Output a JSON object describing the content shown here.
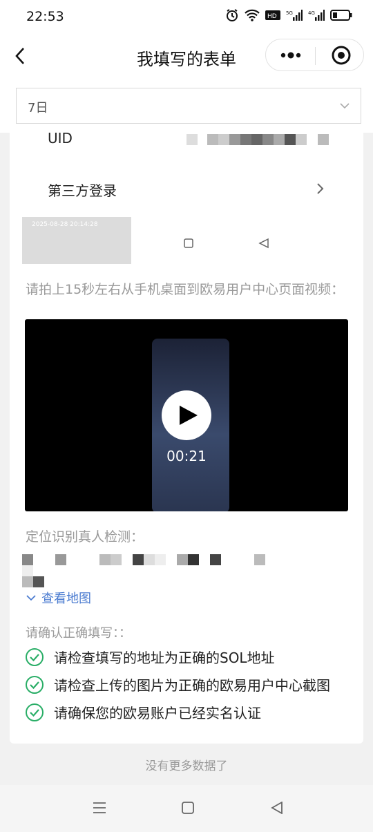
{
  "status": {
    "time": "22:53"
  },
  "nav": {
    "title": "我填写的表单"
  },
  "filter": {
    "selected": "7日"
  },
  "form": {
    "uid_label": "UID",
    "third_party_label": "第三方登录",
    "screenshot_timestamp": "2025-08-28 20:14:28",
    "video_question": "请拍上15秒左右从手机桌面到欧易用户中心页面视频：",
    "video_time": "00:21",
    "location_question": "定位识别真人检测：",
    "map_link": "查看地图",
    "confirm_question": "请确认正确填写：：",
    "checks": [
      "请检查填写的地址为正确的SOL地址",
      "请检查上传的图片为正确的欧易用户中心截图",
      "请确保您的欧易账户已经实名认证"
    ]
  },
  "footer": {
    "no_more": "没有更多数据了"
  },
  "colors": {
    "accent_green": "#2aae67",
    "link_blue": "#4a7bd0",
    "hint_gray": "#999999"
  }
}
